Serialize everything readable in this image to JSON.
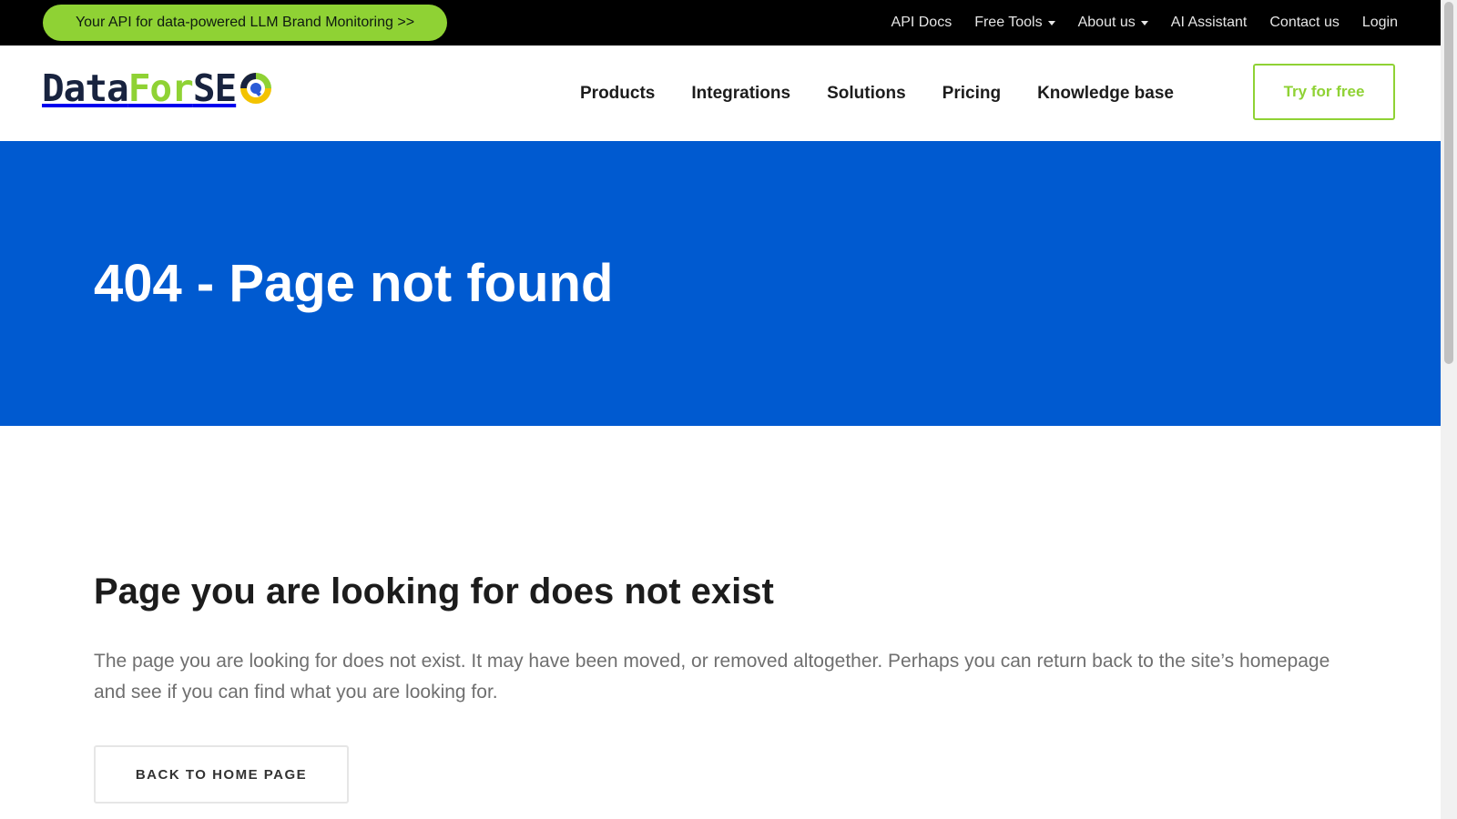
{
  "topbar": {
    "promo_label": "Your API for data-powered LLM Brand Monitoring >>",
    "links": [
      {
        "label": "API Docs",
        "dropdown": false
      },
      {
        "label": "Free Tools",
        "dropdown": true
      },
      {
        "label": "About us",
        "dropdown": true
      },
      {
        "label": "AI Assistant",
        "dropdown": false
      },
      {
        "label": "Contact us",
        "dropdown": false
      },
      {
        "label": "Login",
        "dropdown": false
      }
    ]
  },
  "header": {
    "logo": {
      "part1": "Data",
      "part2": "For",
      "part3": "SE"
    },
    "nav": [
      "Products",
      "Integrations",
      "Solutions",
      "Pricing",
      "Knowledge base"
    ],
    "cta_label": "Try for free"
  },
  "hero": {
    "title": "404 - Page not found"
  },
  "content": {
    "heading": "Page you are looking for does not exist",
    "body": "The page you are looking for does not exist. It may have been moved, or removed altogether. Perhaps you can return back to the site’s homepage and see if you can find what you are looking for.",
    "button_label": "BACK TO HOME PAGE"
  },
  "colors": {
    "accent_green": "#8fd234",
    "hero_blue": "#005ad0",
    "logo_navy": "#18233f",
    "topbar_black": "#000000"
  },
  "icons": {
    "logo_mark": "magnifier-q-icon",
    "dropdown": "caret-down-icon"
  }
}
